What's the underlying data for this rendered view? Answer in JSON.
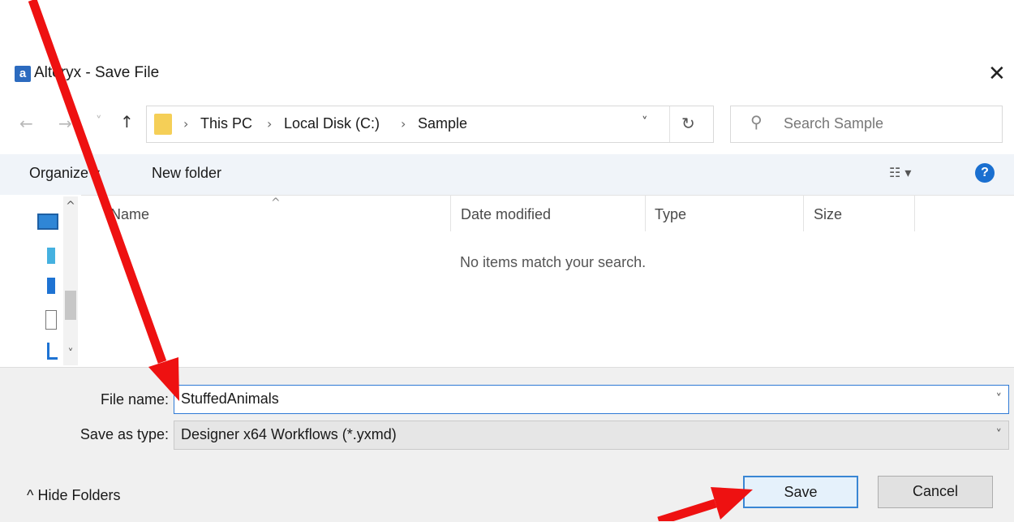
{
  "window": {
    "title": "Alteryx - Save File",
    "app_icon_letter": "a",
    "close_glyph": "✕"
  },
  "nav": {
    "back_glyph": "←",
    "forward_glyph": "→",
    "recent_glyph": "˅",
    "up_glyph": "↑"
  },
  "address": {
    "crumbs": [
      "This PC",
      "Local Disk (C:)",
      "Sample"
    ],
    "separator": "›",
    "dropdown_glyph": "˅",
    "refresh_glyph": "↻"
  },
  "search": {
    "placeholder": "Search Sample",
    "icon_glyph": "⚲"
  },
  "toolbar": {
    "organize_label": "Organize ▾",
    "new_folder_label": "New folder",
    "view_glyph": "☷ ▾",
    "help_glyph": "?"
  },
  "columns": {
    "name": "Name",
    "date_modified": "Date modified",
    "type": "Type",
    "size": "Size",
    "sort_glyph": "^"
  },
  "list": {
    "empty_message": "No items match your search."
  },
  "form": {
    "file_name_label": "File name:",
    "file_name_value": "StuffedAnimals",
    "save_as_type_label": "Save as type:",
    "save_as_type_value": "Designer x64 Workflows (*.yxmd)",
    "chevron_glyph": "˅"
  },
  "footer": {
    "hide_folders_label": "^  Hide Folders",
    "save_label": "Save",
    "cancel_label": "Cancel"
  },
  "colors": {
    "annotation_arrow": "#ee1111",
    "accent": "#2f7ad6",
    "toolbar_bg": "#f0f4f9",
    "panel_bg": "#f0f0f0"
  }
}
